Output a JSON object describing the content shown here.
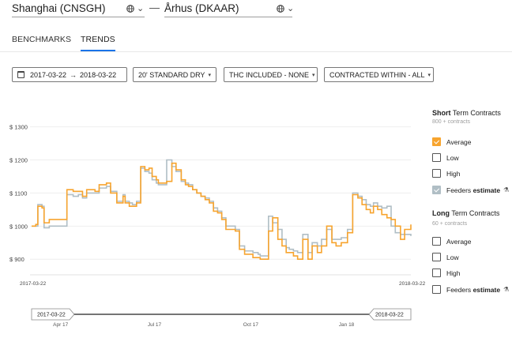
{
  "route": {
    "origin": "Shanghai (CNSGH)",
    "destination": "Århus (DKAAR)",
    "separator": "—",
    "globe_icon": "globe-icon",
    "caret": "⌄"
  },
  "tabs": [
    {
      "label": "BENCHMARKS",
      "active": false
    },
    {
      "label": "TRENDS",
      "active": true
    }
  ],
  "filters": {
    "date_from": "2017-03-22",
    "date_arrow": "→",
    "date_to": "2018-03-22",
    "container": "20' STANDARD DRY",
    "thc": "THC INCLUDED - NONE",
    "contracted": "CONTRACTED WITHIN - ALL",
    "caret": "▾"
  },
  "legend": {
    "short": {
      "title_bold": "Short",
      "title_rest": " Term Contracts",
      "sub": "800 + contracts",
      "items": [
        {
          "label": "Average",
          "checked": true
        },
        {
          "label": "Low",
          "checked": false
        },
        {
          "label": "High",
          "checked": false
        },
        {
          "label": "Feeders",
          "bold": "estimate",
          "checked": true
        }
      ]
    },
    "long": {
      "title_bold": "Long",
      "title_rest": " Term Contracts",
      "sub": "60 + contracts",
      "items": [
        {
          "label": "Average",
          "checked": false
        },
        {
          "label": "Low",
          "checked": false
        },
        {
          "label": "High",
          "checked": false
        },
        {
          "label": "Feeders",
          "bold": "estimate",
          "checked": false
        }
      ]
    }
  },
  "chart_data": {
    "type": "line",
    "title": "",
    "xlabel": "",
    "ylabel": "",
    "x_start_label": "2017-03-22",
    "x_end_label": "2018-03-22",
    "ylim": [
      860,
      1330
    ],
    "y_ticks": [
      "$ 1300",
      "$ 1200",
      "$ 1100",
      "$ 1000",
      "$ 900"
    ],
    "y_tick_values": [
      1300,
      1200,
      1100,
      1000,
      900
    ],
    "colors": {
      "average": "#f7a42e",
      "feeders": "#b0bec5",
      "grid": "#eeeeee"
    },
    "series": [
      {
        "name": "Average",
        "color": "#f7a42e",
        "x": [
          "2017-03-22",
          "2017-03-26",
          "2017-03-28",
          "2017-04-01",
          "2017-04-03",
          "2017-04-08",
          "2017-04-23",
          "2017-04-25",
          "2017-05-01",
          "2017-05-06",
          "2017-05-10",
          "2017-05-14",
          "2017-05-18",
          "2017-05-22",
          "2017-05-26",
          "2017-06-02",
          "2017-06-06",
          "2017-06-12",
          "2017-06-18",
          "2017-06-20",
          "2017-06-24",
          "2017-06-27",
          "2017-07-01",
          "2017-07-05",
          "2017-07-09",
          "2017-07-13",
          "2017-07-16",
          "2017-07-20",
          "2017-07-22",
          "2017-07-26",
          "2017-07-30",
          "2017-08-04",
          "2017-08-08",
          "2017-08-13",
          "2017-08-17",
          "2017-08-20",
          "2017-08-24",
          "2017-08-28",
          "2017-09-01",
          "2017-09-05",
          "2017-09-09",
          "2017-09-13",
          "2017-09-17",
          "2017-09-21",
          "2017-09-25",
          "2017-10-04",
          "2017-10-08",
          "2017-10-13",
          "2017-10-17",
          "2017-10-21",
          "2017-10-26",
          "2017-10-28",
          "2017-11-01",
          "2017-11-05",
          "2017-11-09",
          "2017-11-14",
          "2017-11-18",
          "2017-11-22",
          "2017-11-25",
          "2017-11-29",
          "2017-12-03",
          "2017-12-08",
          "2017-12-13",
          "2017-12-17",
          "2017-12-22",
          "2017-12-26",
          "2017-12-31",
          "2018-01-05",
          "2018-01-09",
          "2018-01-14",
          "2018-01-20",
          "2018-01-25",
          "2018-01-30",
          "2018-02-03",
          "2018-02-07",
          "2018-02-11",
          "2018-02-14",
          "2018-02-18",
          "2018-02-22",
          "2018-02-27",
          "2018-03-03",
          "2018-03-07",
          "2018-03-12",
          "2018-03-16",
          "2018-03-22"
        ],
        "y": [
          1000,
          1005,
          1060,
          1055,
          1010,
          1020,
          1020,
          1110,
          1105,
          1105,
          1090,
          1110,
          1110,
          1105,
          1125,
          1130,
          1100,
          1070,
          1090,
          1070,
          1060,
          1060,
          1070,
          1180,
          1170,
          1175,
          1150,
          1140,
          1130,
          1130,
          1135,
          1190,
          1170,
          1140,
          1125,
          1120,
          1110,
          1100,
          1090,
          1080,
          1070,
          1045,
          1040,
          1020,
          990,
          985,
          930,
          915,
          915,
          905,
          905,
          900,
          900,
          985,
          1025,
          960,
          940,
          920,
          920,
          910,
          900,
          960,
          900,
          940,
          920,
          940,
          1000,
          950,
          940,
          950,
          980,
          1095,
          1085,
          1065,
          1050,
          1040,
          1060,
          1050,
          1035,
          1025,
          1020,
          1000,
          960,
          990,
          1005
        ]
      },
      {
        "name": "Feeders estimate",
        "color": "#b0bec5",
        "x": [
          "2017-03-22",
          "2017-03-26",
          "2017-03-28",
          "2017-04-01",
          "2017-04-03",
          "2017-04-08",
          "2017-04-23",
          "2017-04-25",
          "2017-05-01",
          "2017-05-06",
          "2017-05-10",
          "2017-05-14",
          "2017-05-18",
          "2017-05-22",
          "2017-05-26",
          "2017-06-02",
          "2017-06-06",
          "2017-06-12",
          "2017-06-18",
          "2017-06-20",
          "2017-06-24",
          "2017-06-27",
          "2017-07-01",
          "2017-07-05",
          "2017-07-09",
          "2017-07-13",
          "2017-07-16",
          "2017-07-20",
          "2017-07-22",
          "2017-07-26",
          "2017-07-30",
          "2017-08-04",
          "2017-08-08",
          "2017-08-13",
          "2017-08-17",
          "2017-08-20",
          "2017-08-24",
          "2017-08-28",
          "2017-09-01",
          "2017-09-05",
          "2017-09-09",
          "2017-09-13",
          "2017-09-17",
          "2017-09-21",
          "2017-09-25",
          "2017-10-04",
          "2017-10-08",
          "2017-10-13",
          "2017-10-17",
          "2017-10-21",
          "2017-10-26",
          "2017-10-28",
          "2017-11-01",
          "2017-11-05",
          "2017-11-09",
          "2017-11-14",
          "2017-11-18",
          "2017-11-22",
          "2017-11-25",
          "2017-11-29",
          "2017-12-03",
          "2017-12-08",
          "2017-12-13",
          "2017-12-17",
          "2017-12-22",
          "2017-12-26",
          "2017-12-31",
          "2018-01-05",
          "2018-01-09",
          "2018-01-14",
          "2018-01-20",
          "2018-01-25",
          "2018-01-30",
          "2018-02-03",
          "2018-02-07",
          "2018-02-11",
          "2018-02-14",
          "2018-02-18",
          "2018-02-22",
          "2018-02-27",
          "2018-03-03",
          "2018-03-07",
          "2018-03-12",
          "2018-03-16",
          "2018-03-22"
        ],
        "y": [
          1000,
          1000,
          1065,
          1060,
          995,
          1000,
          1000,
          1095,
          1090,
          1095,
          1085,
          1100,
          1100,
          1100,
          1115,
          1120,
          1105,
          1075,
          1095,
          1075,
          1070,
          1065,
          1075,
          1175,
          1165,
          1160,
          1140,
          1130,
          1125,
          1125,
          1200,
          1180,
          1165,
          1135,
          1130,
          1125,
          1110,
          1100,
          1090,
          1085,
          1075,
          1055,
          1045,
          1025,
          1000,
          990,
          940,
          925,
          925,
          920,
          915,
          910,
          910,
          1030,
          1010,
          990,
          960,
          935,
          930,
          925,
          920,
          975,
          920,
          950,
          940,
          960,
          990,
          960,
          960,
          965,
          990,
          1100,
          1090,
          1080,
          1065,
          1060,
          1070,
          1060,
          1055,
          1060,
          1000,
          980,
          975,
          975,
          970
        ]
      }
    ],
    "navigator": {
      "start_label": "2017-03-22",
      "end_label": "2018-03-22",
      "ticks": [
        "Apr 17",
        "Jul 17",
        "Oct 17",
        "Jan 18"
      ]
    }
  }
}
